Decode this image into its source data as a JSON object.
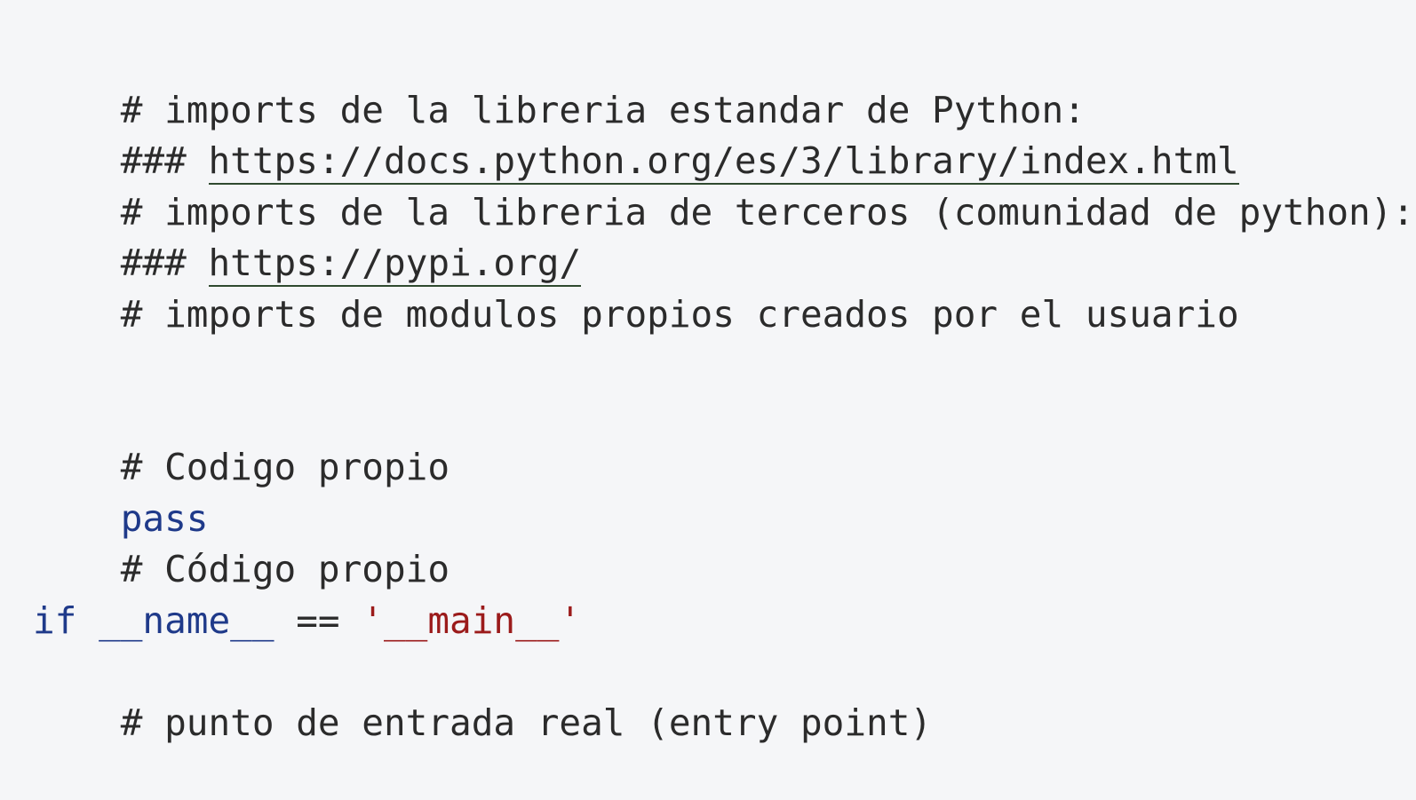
{
  "code": {
    "line1": "# imports de la libreria estandar de Python:",
    "line2_prefix": "### ",
    "line2_link": "https://docs.python.org/es/3/library/index.html",
    "line3": "# imports de la libreria de terceros (comunidad de python):",
    "line4_prefix": "### ",
    "line4_link": "https://pypi.org/",
    "line5": "# imports de modulos propios creados por el usuario",
    "line8": "# Codigo propio",
    "line9_keyword": "pass",
    "line10": "# Código propio",
    "line12_kw_if": "if",
    "line12_name": "__name__",
    "line12_op": "==",
    "line12_str": "'__main__'",
    "line13": "# punto de entrada real (entry point)"
  },
  "colors": {
    "background": "#f5f6f8",
    "text": "#2b2b2b",
    "keyword": "#1f3a8a",
    "string": "#9b1b1b"
  }
}
